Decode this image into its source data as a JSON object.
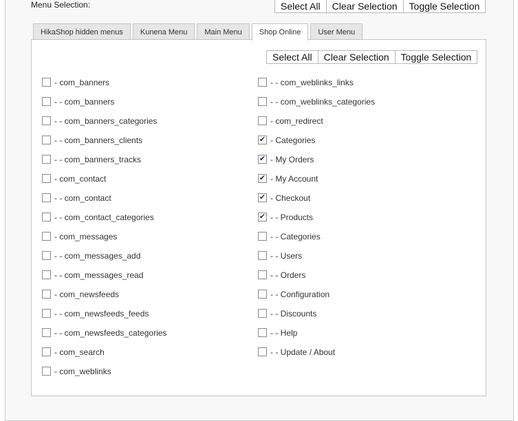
{
  "menu_selection_label": "Menu Selection:",
  "buttons": {
    "select_all": "Select All",
    "clear_selection": "Clear Selection",
    "toggle_selection": "Toggle Selection"
  },
  "tabs": [
    {
      "label": "HikaShop hidden menus",
      "active": false
    },
    {
      "label": "Kunena Menu",
      "active": false
    },
    {
      "label": "Main Menu",
      "active": false
    },
    {
      "label": "Shop Online",
      "active": true
    },
    {
      "label": "User Menu",
      "active": false
    }
  ],
  "left_items": [
    {
      "label": "- com_banners",
      "checked": false
    },
    {
      "label": "- - com_banners",
      "checked": false
    },
    {
      "label": "- - com_banners_categories",
      "checked": false
    },
    {
      "label": "- - com_banners_clients",
      "checked": false
    },
    {
      "label": "- - com_banners_tracks",
      "checked": false
    },
    {
      "label": "- com_contact",
      "checked": false
    },
    {
      "label": "- - com_contact",
      "checked": false
    },
    {
      "label": "- - com_contact_categories",
      "checked": false
    },
    {
      "label": "- com_messages",
      "checked": false
    },
    {
      "label": "- - com_messages_add",
      "checked": false
    },
    {
      "label": "- - com_messages_read",
      "checked": false
    },
    {
      "label": "- com_newsfeeds",
      "checked": false
    },
    {
      "label": "- - com_newsfeeds_feeds",
      "checked": false
    },
    {
      "label": "- - com_newsfeeds_categories",
      "checked": false
    },
    {
      "label": "- com_search",
      "checked": false
    },
    {
      "label": "- com_weblinks",
      "checked": false
    }
  ],
  "right_items": [
    {
      "label": "- - com_weblinks_links",
      "checked": false
    },
    {
      "label": "- - com_weblinks_categories",
      "checked": false
    },
    {
      "label": "- com_redirect",
      "checked": false
    },
    {
      "label": "- Categories",
      "checked": true
    },
    {
      "label": "- My Orders",
      "checked": true
    },
    {
      "label": "- My Account",
      "checked": true
    },
    {
      "label": "- Checkout",
      "checked": true
    },
    {
      "label": "- - Products",
      "checked": true
    },
    {
      "label": "- - Categories",
      "checked": false
    },
    {
      "label": "- - Users",
      "checked": false
    },
    {
      "label": "- - Orders",
      "checked": false
    },
    {
      "label": "- - Configuration",
      "checked": false
    },
    {
      "label": "- - Discounts",
      "checked": false
    },
    {
      "label": "- - Help",
      "checked": false
    },
    {
      "label": "- - Update / About",
      "checked": false
    }
  ]
}
